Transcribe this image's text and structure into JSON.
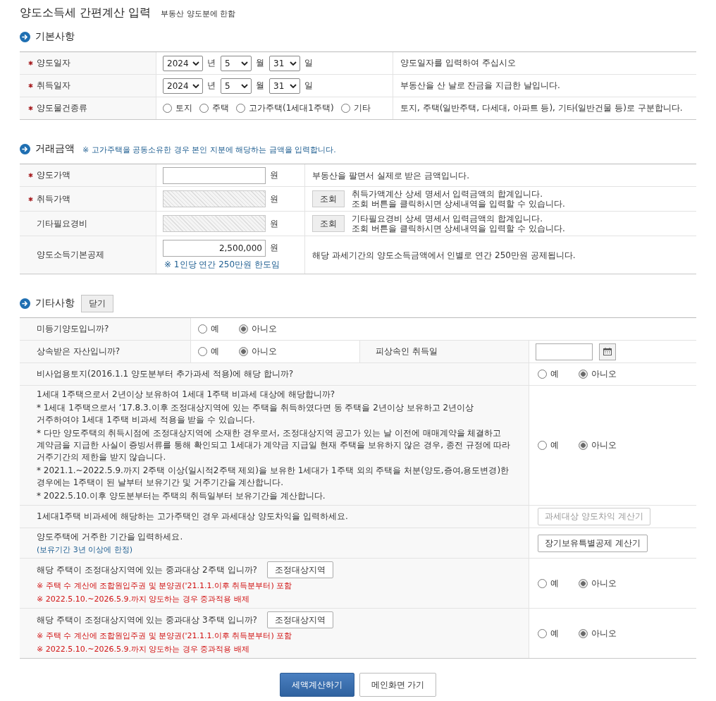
{
  "page": {
    "title": "양도소득세 간편계산 입력",
    "subtitle": "부동산 양도분에 한함"
  },
  "basic": {
    "heading": "기본사항",
    "rows": [
      {
        "kind": "date",
        "required": true,
        "label": "양도일자",
        "year": "2024",
        "year_unit": "년",
        "month": "5",
        "month_unit": "월",
        "day": "31",
        "day_unit": "일",
        "description": "양도일자를 입력하여 주십시오"
      },
      {
        "kind": "date",
        "required": true,
        "label": "취득일자",
        "year": "2024",
        "year_unit": "년",
        "month": "5",
        "month_unit": "월",
        "day": "31",
        "day_unit": "일",
        "description": "부동산을 산 날로 잔금을 지급한 날입니다."
      },
      {
        "kind": "radio",
        "required": true,
        "label": "양도물건종류",
        "options": [
          {
            "label": "토지",
            "selected": false
          },
          {
            "label": "주택",
            "selected": false
          },
          {
            "label": "고가주택(1세대1주택)",
            "selected": false
          },
          {
            "label": "기타",
            "selected": false
          }
        ],
        "description": "토지, 주택(일반주택, 다세대, 아파트 등), 기타(일반건물 등)로 구분합니다."
      }
    ]
  },
  "amounts": {
    "heading": "거래금액",
    "note": "※ 고가주택을 공동소유한 경우 본인 지분에 해당하는 금액을 입력합니다.",
    "rows": [
      {
        "required": true,
        "label": "양도가액",
        "disabled": false,
        "unit": "원",
        "description": [
          "부동산을 팔면서 실제로 받은 금액입니다."
        ]
      },
      {
        "required": true,
        "label": "취득가액",
        "disabled": true,
        "unit": "원",
        "button": "조회",
        "description": [
          "취득가액계산 상세 명세서 입력금액의 합계입니다.",
          "조회 버튼을 클릭하시면 상세내역을 입력할 수 있습니다."
        ]
      },
      {
        "required": false,
        "label": "기타필요경비",
        "disabled": true,
        "unit": "원",
        "button": "조회",
        "description": [
          "기타필요경비 상세 명세서 입력금액의 합계입니다.",
          "조회 버튼을 클릭하시면 상세내역을 입력할 수 있습니다."
        ]
      },
      {
        "required": false,
        "label": "양도소득기본공제",
        "disabled": false,
        "value": "2,500,000",
        "unit": "원",
        "note": "※ 1인당 연간 250만원 한도임",
        "description": [
          "해당 과세기간의 양도소득금액에서 인별로 연간 250만원 공제됩니다."
        ]
      }
    ]
  },
  "other": {
    "heading": "기타사항",
    "toggle": "닫기",
    "rows": [
      {
        "kind": "choice",
        "question": "미등기양도입니까?",
        "options": [
          {
            "label": "예",
            "selected": false
          },
          {
            "label": "아니오",
            "selected": true
          }
        ]
      },
      {
        "kind": "choice_date",
        "question": "상속받은 자산입니까?",
        "options": [
          {
            "label": "예",
            "selected": false
          },
          {
            "label": "아니오",
            "selected": true
          }
        ],
        "date_label": "피상속인 취득일"
      },
      {
        "kind": "question",
        "question": "비사업용토지(2016.1.1 양도분부터 추가과세 적용)에 해당 합니까?",
        "options": [
          {
            "label": "예",
            "selected": false
          },
          {
            "label": "아니오",
            "selected": true
          }
        ]
      },
      {
        "kind": "question",
        "question": "1세대 1주택으로서 2년이상 보유하여 1세대 1주택 비과세 대상에 해당합니까?",
        "notes": [
          "* 1세대 1주택으로서 ‘17.8.3.이후 조정대상지역에 있는 주택을 취득하였다면 동 주택을 2년이상 보유하고 2년이상 거주하여야 1세대 1주택 비과세 적용을 받을 수 있습니다.",
          "* 다만 양도주택의 취득시점에 조정대상지역에 소재한 경우로서, 조정대상지역 공고가 있는 날 이전에 매매계약을 체결하고 계약금을 지급한 사실이 증빙서류를 통해 확인되고 1세대가 계약금 지급일 현재 주택을 보유하지 않은 경우, 종전 규정에 따라 거주기간의 제한을 받지 않습니다.",
          "* 2021.1.~2022.5.9.까지 2주택 이상(일시적2주택 제외)을 보유한 1세대가 1주택 외의 주택을 처분(양도,증여,용도변경)한 경우에는 1주택이 된 날부터 보유기간 및 거주기간을 계산합니다.",
          "* 2022.5.10.이후 양도분부터는 주택의 취득일부터 보유기간을 계산합니다."
        ],
        "options": [
          {
            "label": "예",
            "selected": false
          },
          {
            "label": "아니오",
            "selected": true
          }
        ]
      },
      {
        "kind": "calculator",
        "question": "1세대1주택 비과세에 해당하는 고가주택인 경우 과세대상 양도차익을 입력하세요.",
        "button": "과세대상 양도차익 계산기",
        "disabled": true
      },
      {
        "kind": "calculator",
        "question": "양도주택에 거주한 기간을 입력하세요.",
        "hint": "(보유기간 3년 이상에 한정)",
        "button": "장기보유특별공제 계산기",
        "disabled": false
      },
      {
        "kind": "question",
        "question": "해당 주택이 조정대상지역에 있는 중과대상 2주택 입니까?",
        "link_button": "조정대상지역",
        "warnings": [
          "※ 주택 수 계산에 조합원입주권 및 분양권('21.1.1.이후 취득분부터) 포함",
          "※ 2022.5.10.~2026.5.9.까지 양도하는 경우 중과적용 배제"
        ],
        "options": [
          {
            "label": "예",
            "selected": false
          },
          {
            "label": "아니오",
            "selected": true
          }
        ]
      },
      {
        "kind": "question",
        "question": "해당 주택이 조정대상지역에 있는 중과대상 3주택 입니까?",
        "link_button": "조정대상지역",
        "warnings": [
          "※ 주택 수 계산에 조합원입주권 및 분양권('21.1.1.이후 취득분부터) 포함",
          "※ 2022.5.10.~2026.5.9.까지 양도하는 경우 중과적용 배제"
        ],
        "options": [
          {
            "label": "예",
            "selected": false
          },
          {
            "label": "아니오",
            "selected": true
          }
        ]
      }
    ]
  },
  "actions": [
    {
      "kind": "primary",
      "label": "세액계산하기"
    },
    {
      "kind": "secondary",
      "label": "메인화면 가기"
    }
  ]
}
